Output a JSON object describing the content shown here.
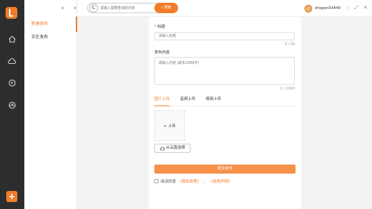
{
  "rail": {
    "icons": [
      "logo-icon",
      "home-icon",
      "cloud-icon",
      "chat-icon",
      "dashboard-icon",
      "plus-icon"
    ]
  },
  "sidebar": {
    "items": [
      {
        "label": "新建发布"
      },
      {
        "label": "正在发布"
      }
    ]
  },
  "topbar": {
    "back": "‹",
    "forward": "›",
    "refresh": "C",
    "search_placeholder": "请输入需要查询的内容",
    "search_button": "⌕ 搜索",
    "username": "dragon93440",
    "window_controls": [
      "–",
      "⤢",
      "✕"
    ]
  },
  "form": {
    "title_required_mark": "*",
    "title_label": "标题",
    "title_placeholder": "请输入标题",
    "title_counter": "0 / 30",
    "content_label": "发布内容",
    "content_placeholder": "请输入内容 (最多1000字)",
    "content_counter": "0 / 1000",
    "tabs": [
      {
        "label": "图片上传"
      },
      {
        "label": "音频上传"
      },
      {
        "label": "视频上传"
      }
    ],
    "upload_label": "+ 上传",
    "cloud_button": "从云盘选择",
    "submit_button": "提交发布",
    "agree_prefix": "阅读同意",
    "privacy_link": "《隐私政策》",
    "separator": "、",
    "disclaimer_link": "《免责声明》"
  },
  "colors": {
    "accent": "#f07c2a",
    "rail": "#2d2d2d"
  }
}
